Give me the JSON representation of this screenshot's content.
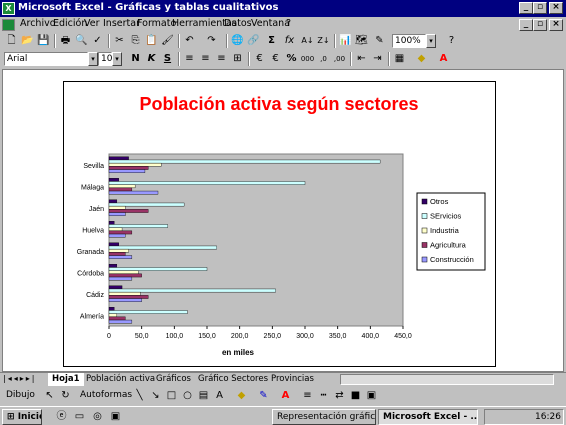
{
  "window": {
    "title": "Microsoft Excel - Gráficas y tablas cualitativos"
  },
  "menu": [
    "Archivo",
    "Edición",
    "Ver",
    "Insertar",
    "Formato",
    "Herramientas",
    "Datos",
    "Ventana",
    "?"
  ],
  "toolbar": {
    "zoom": "100%",
    "font_name": "Arial",
    "font_size": "10"
  },
  "chart_data": {
    "type": "bar",
    "title": "Población activa según sectores",
    "xlabel": "en miles",
    "xlim": [
      0,
      450
    ],
    "xticks": [
      "0",
      "50,0",
      "100,0",
      "150,0",
      "200,0",
      "250,0",
      "300,0",
      "350,0",
      "400,0",
      "450,0"
    ],
    "categories": [
      "Sevilla",
      "Málaga",
      "Jaén",
      "Huelva",
      "Granada",
      "Córdoba",
      "Cádiz",
      "Almería"
    ],
    "series": [
      {
        "name": "Otros",
        "color": "#330066",
        "values": [
          30,
          15,
          12,
          8,
          15,
          12,
          20,
          8
        ]
      },
      {
        "name": "SErvicios",
        "color": "#ccffff",
        "values": [
          415,
          300,
          115,
          90,
          165,
          150,
          255,
          120
        ]
      },
      {
        "name": "Industria",
        "color": "#ffffcc",
        "values": [
          80,
          40,
          25,
          20,
          30,
          45,
          48,
          12
        ]
      },
      {
        "name": "Agricultura",
        "color": "#993366",
        "values": [
          60,
          35,
          60,
          35,
          25,
          50,
          60,
          25
        ]
      },
      {
        "name": "Construcción",
        "color": "#9999ff",
        "values": [
          55,
          75,
          25,
          25,
          35,
          35,
          50,
          35
        ]
      }
    ],
    "legend_position": "right"
  },
  "sheet_tabs": [
    "Hoja1",
    "Población activa",
    "Gráficos",
    "Gráfico Sectores",
    "Provincias"
  ],
  "drawing": {
    "dibujo_label": "Dibujo",
    "autoformas_label": "Autoformas"
  },
  "taskbar": {
    "start_label": "Inicio",
    "items": [
      "Representación gráfic...",
      "Microsoft Excel - ..."
    ],
    "clock": "16:26"
  }
}
